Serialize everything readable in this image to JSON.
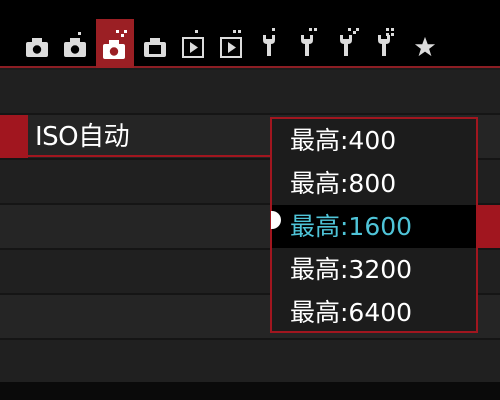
{
  "tabs": [
    {
      "icon": "camera-icon",
      "dots": 1,
      "active": false
    },
    {
      "icon": "camera-icon",
      "dots": 2,
      "active": false
    },
    {
      "icon": "camera-icon",
      "dots": 3,
      "active": true
    },
    {
      "icon": "camera-icon",
      "dots": 4,
      "active": false
    },
    {
      "icon": "playback-icon",
      "dots": 1,
      "active": false
    },
    {
      "icon": "playback-icon",
      "dots": 2,
      "active": false
    },
    {
      "icon": "wrench-icon",
      "dots": 1,
      "active": false
    },
    {
      "icon": "wrench-icon",
      "dots": 2,
      "active": false
    },
    {
      "icon": "wrench-icon",
      "dots": 3,
      "active": false
    },
    {
      "icon": "wrench-icon",
      "dots": 4,
      "active": false
    },
    {
      "icon": "star-icon",
      "dots": 0,
      "active": false
    }
  ],
  "menu": {
    "item_label": "ISO自动"
  },
  "dropdown": {
    "options": [
      {
        "label": "最高:400",
        "selected": false
      },
      {
        "label": "最高:800",
        "selected": false
      },
      {
        "label": "最高:1600",
        "selected": true
      },
      {
        "label": "最高:3200",
        "selected": false
      },
      {
        "label": "最高:6400",
        "selected": false
      }
    ]
  },
  "colors": {
    "accent": "#a1161f",
    "selected_text": "#4fc4d8",
    "background": "#1c1c1c"
  }
}
